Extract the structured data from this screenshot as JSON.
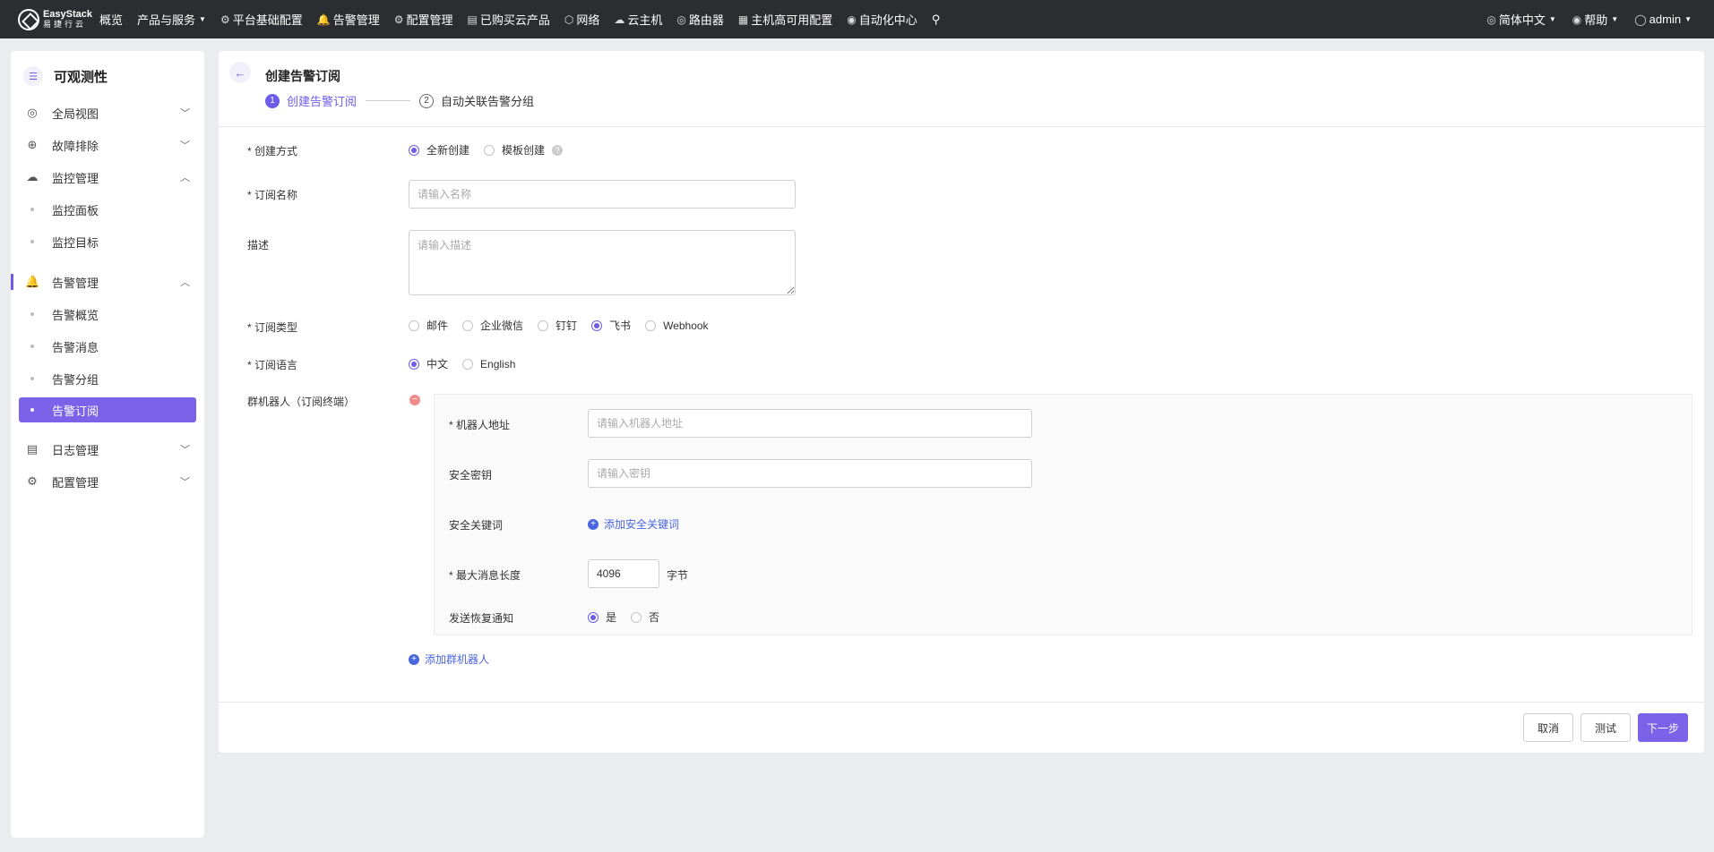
{
  "topbar": {
    "logo_en": "EasyStack",
    "logo_cn": "易捷行云",
    "nav": [
      {
        "label": "概览",
        "icon": "",
        "caret": false
      },
      {
        "label": "产品与服务",
        "icon": "",
        "caret": true
      },
      {
        "label": "平台基础配置",
        "icon": "⚙",
        "caret": false
      },
      {
        "label": "告警管理",
        "icon": "🔔",
        "caret": false
      },
      {
        "label": "配置管理",
        "icon": "⚙",
        "caret": false
      },
      {
        "label": "已购买云产品",
        "icon": "▤",
        "caret": false
      },
      {
        "label": "网络",
        "icon": "⬡",
        "caret": false
      },
      {
        "label": "云主机",
        "icon": "☁",
        "caret": false
      },
      {
        "label": "路由器",
        "icon": "◎",
        "caret": false
      },
      {
        "label": "主机高可用配置",
        "icon": "▦",
        "caret": false
      },
      {
        "label": "自动化中心",
        "icon": "◉",
        "caret": false
      }
    ],
    "pin_icon": "⚲",
    "language": "简体中文",
    "help": "帮助",
    "user": "admin"
  },
  "sidebar": {
    "title": "可观测性",
    "items": [
      {
        "label": "全局视图",
        "icon": "◎"
      },
      {
        "label": "故障排除",
        "icon": "⊕"
      },
      {
        "label": "监控管理",
        "icon": "☁"
      },
      {
        "label": "告警管理",
        "icon": "🔔"
      },
      {
        "label": "日志管理",
        "icon": "▤"
      },
      {
        "label": "配置管理",
        "icon": "⚙"
      }
    ],
    "monitor_subs": [
      "监控面板",
      "监控目标"
    ],
    "alert_subs": [
      "告警概览",
      "告警消息",
      "告警分组",
      "告警订阅"
    ]
  },
  "main": {
    "title": "创建告警订阅",
    "steps": [
      {
        "num": "1",
        "label": "创建告警订阅"
      },
      {
        "num": "2",
        "label": "自动关联告警分组"
      }
    ],
    "form": {
      "create_mode_label": "* 创建方式",
      "create_mode_options": [
        "全新创建",
        "模板创建"
      ],
      "name_label": "* 订阅名称",
      "name_placeholder": "请输入名称",
      "desc_label": "描述",
      "desc_placeholder": "请输入描述",
      "type_label": "* 订阅类型",
      "type_options": [
        "邮件",
        "企业微信",
        "钉钉",
        "飞书",
        "Webhook"
      ],
      "lang_label": "* 订阅语言",
      "lang_options": [
        "中文",
        "English"
      ],
      "robot_label": "群机器人（订阅终端）",
      "robot": {
        "address_label": "* 机器人地址",
        "address_placeholder": "请输入机器人地址",
        "secret_label": "安全密钥",
        "secret_placeholder": "请输入密钥",
        "keyword_label": "安全关键词",
        "add_keyword": "添加安全关键词",
        "maxlen_label": "* 最大消息长度",
        "maxlen_value": "4096",
        "maxlen_unit": "字节",
        "recovery_label": "发送恢复通知",
        "recovery_options": [
          "是",
          "否"
        ]
      },
      "add_robot": "添加群机器人"
    },
    "buttons": {
      "cancel": "取消",
      "test": "测试",
      "next": "下一步"
    }
  },
  "colors": {
    "accent": "#7a63e8",
    "link": "#4a65e0",
    "topbar": "#2c2d30"
  }
}
